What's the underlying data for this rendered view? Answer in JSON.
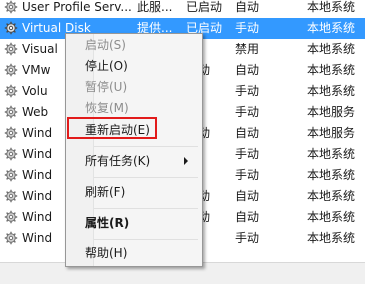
{
  "services": [
    {
      "name": "User Profile Serv...",
      "desc": "此服...",
      "status": "已启动",
      "startup": "自动",
      "logon": "本地系统",
      "selected": false
    },
    {
      "name": "Virtual Disk",
      "desc": "提供...",
      "status": "已启动",
      "startup": "手动",
      "logon": "本地系统",
      "selected": true
    },
    {
      "name": "Visual",
      "desc": "",
      "status": "",
      "startup": "禁用",
      "logon": "本地系统",
      "selected": false
    },
    {
      "name": "VMw",
      "desc": "",
      "status": "启动",
      "startup": "自动",
      "logon": "本地系统",
      "selected": false
    },
    {
      "name": "Volu",
      "desc": "",
      "status": "",
      "startup": "手动",
      "logon": "本地系统",
      "selected": false
    },
    {
      "name": "Web",
      "desc": "",
      "status": "",
      "startup": "手动",
      "logon": "本地服务",
      "selected": false
    },
    {
      "name": "Wind",
      "desc": "",
      "status": "启动",
      "startup": "自动",
      "logon": "本地服务",
      "selected": false
    },
    {
      "name": "Wind",
      "desc": "",
      "status": "",
      "startup": "手动",
      "logon": "本地系统",
      "selected": false
    },
    {
      "name": "Wind",
      "desc": "",
      "status": "",
      "startup": "手动",
      "logon": "本地系统",
      "selected": false
    },
    {
      "name": "Wind",
      "desc": "",
      "status": "启动",
      "startup": "自动",
      "logon": "本地系统",
      "selected": false
    },
    {
      "name": "Wind",
      "desc": "",
      "status": "启动",
      "startup": "自动",
      "logon": "本地系统",
      "selected": false
    },
    {
      "name": "Wind",
      "desc": "",
      "status": "",
      "startup": "手动",
      "logon": "本地系统",
      "selected": false
    }
  ],
  "context_menu": {
    "items": [
      {
        "label": "启动(S)",
        "disabled": true
      },
      {
        "label": "停止(O)",
        "disabled": false
      },
      {
        "label": "暂停(U)",
        "disabled": true
      },
      {
        "label": "恢复(M)",
        "disabled": true
      },
      {
        "label": "重新启动(E)",
        "disabled": false,
        "highlighted": true
      },
      {
        "label": "所有任务(K)",
        "disabled": false,
        "submenu": true
      },
      {
        "label": "刷新(F)",
        "disabled": false
      },
      {
        "label": "属性(R)",
        "disabled": false,
        "bold": true
      },
      {
        "label": "帮助(H)",
        "disabled": false
      }
    ]
  },
  "colors": {
    "selection": "#3399ff",
    "highlight_box": "#e21b1b"
  },
  "icons": {
    "service_icon": "gear-icon",
    "submenu_arrow": "chevron-right-icon"
  }
}
